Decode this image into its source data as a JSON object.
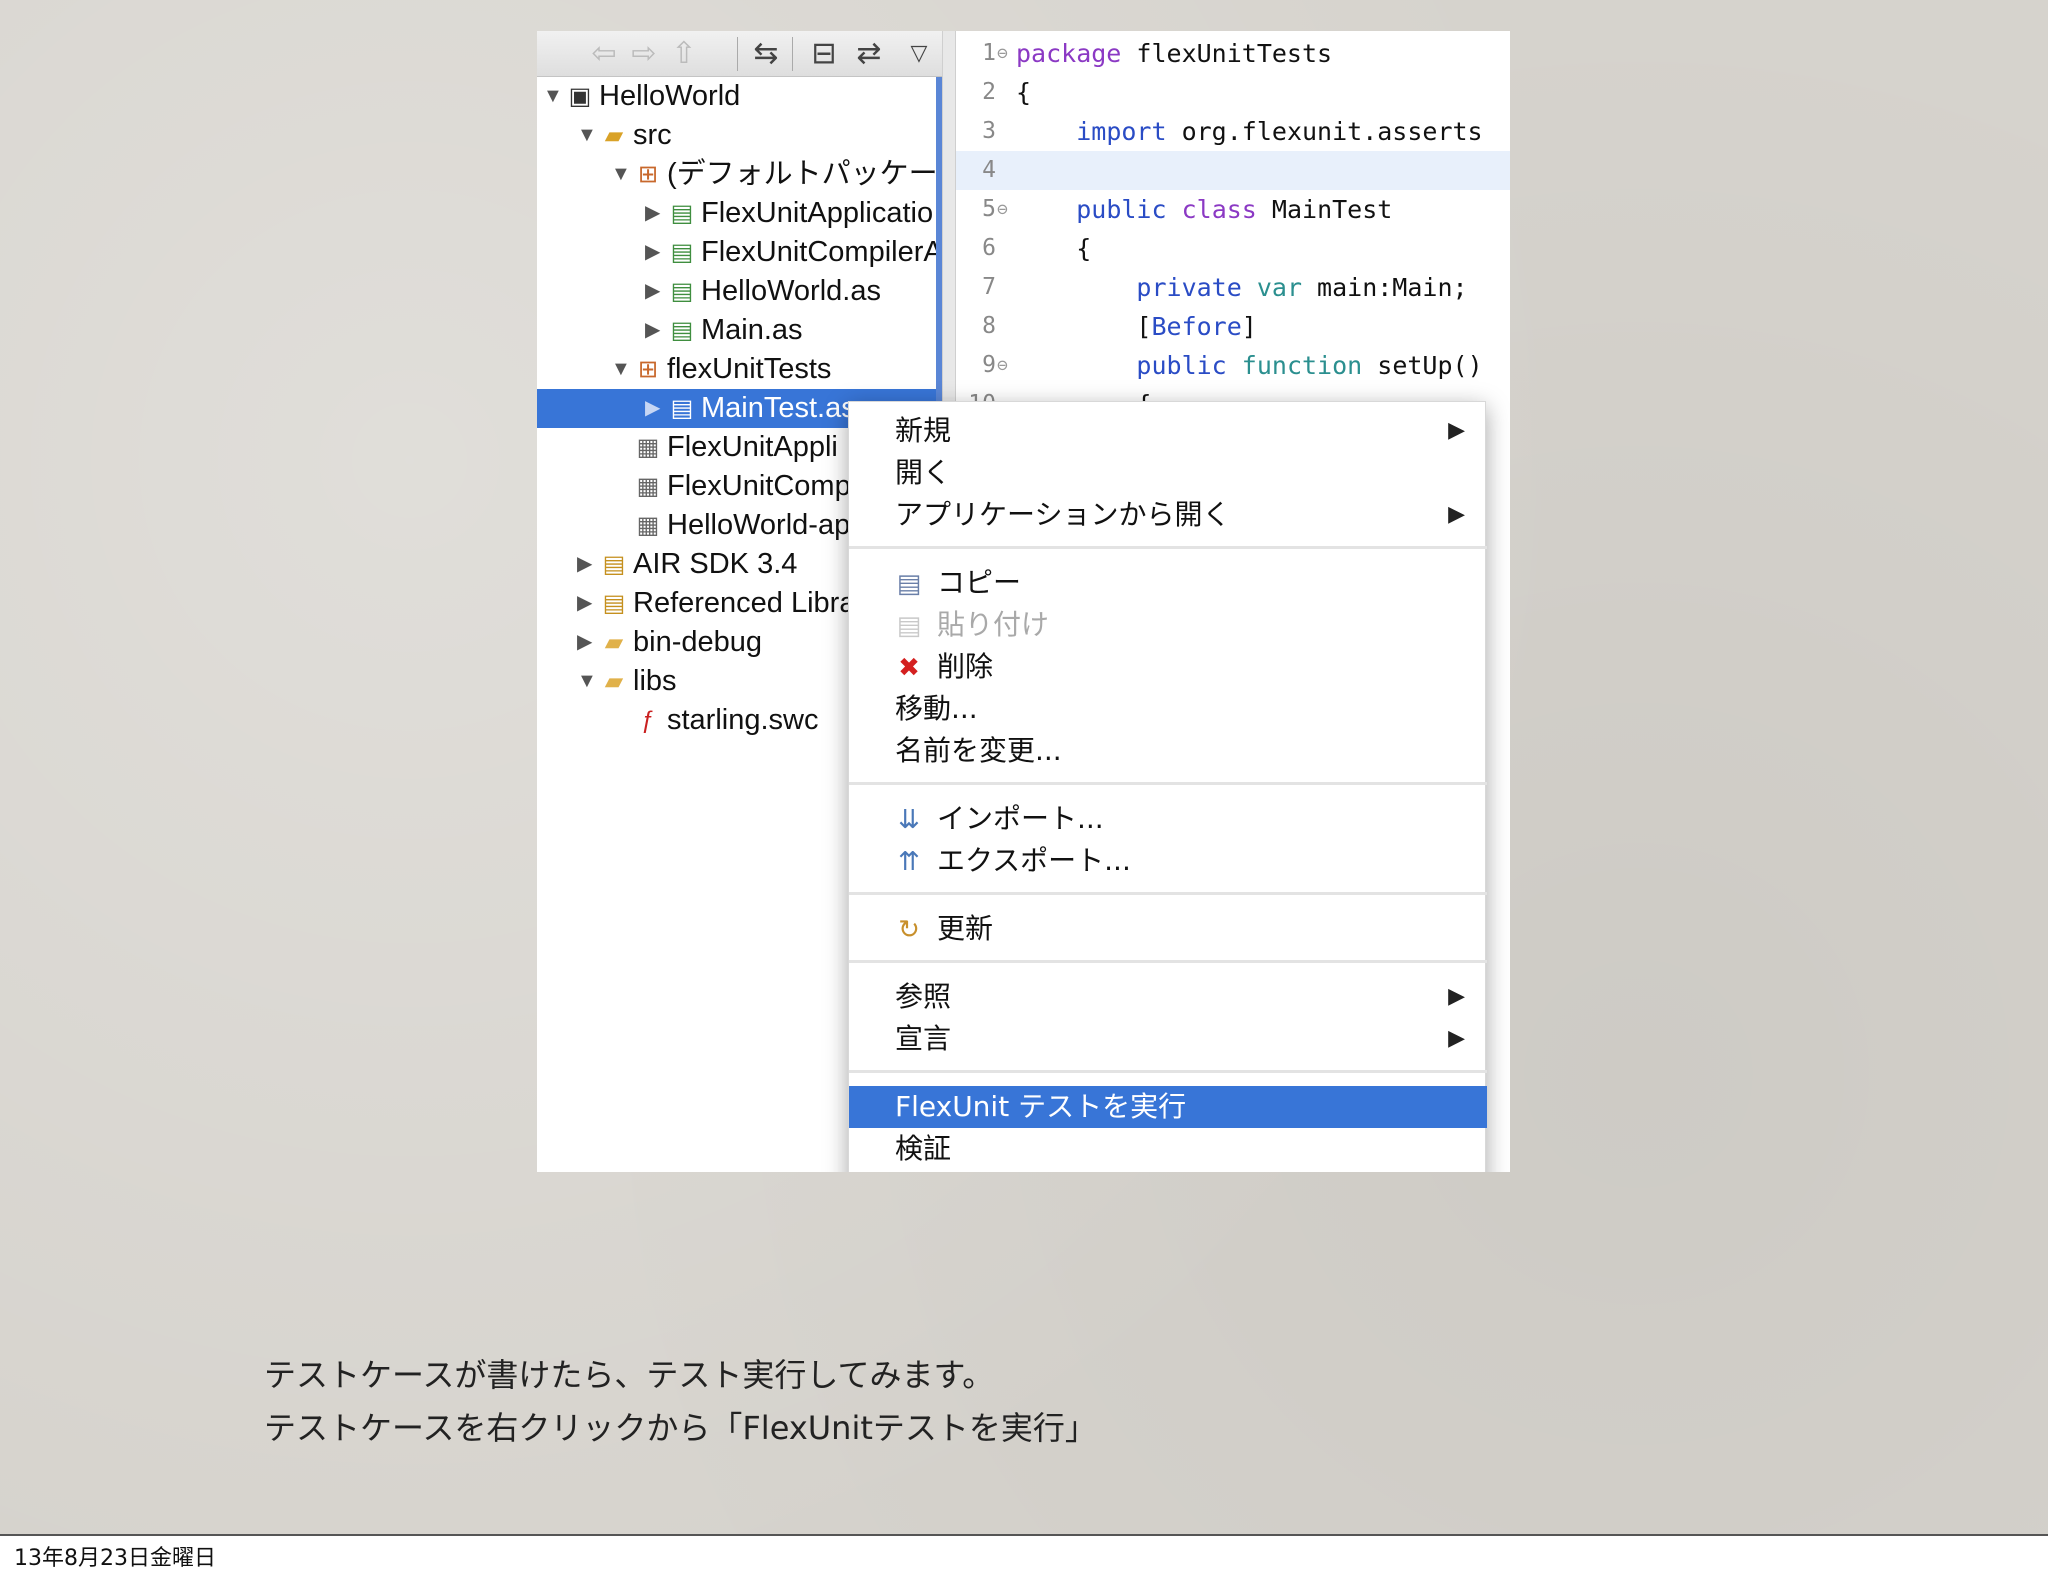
{
  "explorer": {
    "rows": [
      {
        "label": "HelloWorld",
        "expanded": true,
        "icon": "project-icon"
      },
      {
        "label": "src",
        "expanded": true,
        "icon": "source-folder-icon"
      },
      {
        "label": "(デフォルトパッケージ",
        "expanded": true,
        "icon": "package-icon"
      },
      {
        "label": "FlexUnitApplicatio",
        "expanded": false,
        "icon": "as-file-icon"
      },
      {
        "label": "FlexUnitCompilerA",
        "expanded": false,
        "icon": "as-file-icon"
      },
      {
        "label": "HelloWorld.as",
        "expanded": false,
        "icon": "as-file-icon"
      },
      {
        "label": "Main.as",
        "expanded": false,
        "icon": "as-file-icon"
      },
      {
        "label": "flexUnitTests",
        "expanded": true,
        "icon": "package-icon"
      },
      {
        "label": "MainTest.as",
        "expanded": false,
        "icon": "as-file-icon",
        "selected": true
      },
      {
        "label": "FlexUnitAppli",
        "icon": "mxml-file-icon"
      },
      {
        "label": "FlexUnitComp",
        "icon": "mxml-file-icon"
      },
      {
        "label": "HelloWorld-ap",
        "icon": "mxml-file-icon"
      },
      {
        "label": "AIR SDK 3.4",
        "expanded": false,
        "icon": "library-icon"
      },
      {
        "label": "Referenced Libra",
        "expanded": false,
        "icon": "library-icon"
      },
      {
        "label": "bin-debug",
        "expanded": false,
        "icon": "folder-icon"
      },
      {
        "label": "libs",
        "expanded": true,
        "icon": "folder-icon"
      },
      {
        "label": "starling.swc",
        "icon": "swc-file-icon"
      }
    ]
  },
  "editor": {
    "lines": [
      {
        "num": "1",
        "fold": "⊖",
        "tokens": [
          [
            "kw",
            "package"
          ],
          [
            "",
            " flexUnitTests"
          ]
        ]
      },
      {
        "num": "2",
        "fold": "",
        "tokens": [
          [
            "",
            "{"
          ]
        ]
      },
      {
        "num": "3",
        "fold": "",
        "tokens": [
          [
            "",
            "    "
          ],
          [
            "kb",
            "import"
          ],
          [
            "",
            " org.flexunit.asserts"
          ]
        ]
      },
      {
        "num": "4",
        "fold": "",
        "tokens": [
          [
            "",
            ""
          ]
        ]
      },
      {
        "num": "5",
        "fold": "⊖",
        "tokens": [
          [
            "",
            "    "
          ],
          [
            "kb",
            "public"
          ],
          [
            "",
            " "
          ],
          [
            "kw",
            "class"
          ],
          [
            "",
            " MainTest"
          ]
        ]
      },
      {
        "num": "6",
        "fold": "",
        "tokens": [
          [
            "",
            "    {"
          ]
        ]
      },
      {
        "num": "7",
        "fold": "",
        "tokens": [
          [
            "",
            "        "
          ],
          [
            "kb",
            "private"
          ],
          [
            "",
            " "
          ],
          [
            "kt",
            "var"
          ],
          [
            "",
            " main:Main;"
          ]
        ]
      },
      {
        "num": "8",
        "fold": "",
        "tokens": [
          [
            "",
            "        ["
          ],
          [
            "kb",
            "Before"
          ],
          [
            "",
            "]"
          ]
        ]
      },
      {
        "num": "9",
        "fold": "⊖",
        "tokens": [
          [
            "",
            "        "
          ],
          [
            "kb",
            "public"
          ],
          [
            "",
            " "
          ],
          [
            "kt",
            "function"
          ],
          [
            "",
            " setUp()"
          ]
        ]
      },
      {
        "num": "10",
        "fold": "",
        "tokens": [
          [
            "",
            "        {"
          ]
        ]
      }
    ]
  },
  "context_menu": {
    "items": [
      {
        "label": "新規",
        "submenu": true
      },
      {
        "label": "開く"
      },
      {
        "label": "アプリケーションから開く",
        "submenu": true
      },
      {
        "sep": true
      },
      {
        "label": "コピー",
        "icon": "copy-icon"
      },
      {
        "label": "貼り付け",
        "icon": "paste-icon",
        "disabled": true
      },
      {
        "label": "削除",
        "icon": "delete-icon"
      },
      {
        "label": "移動..."
      },
      {
        "label": "名前を変更..."
      },
      {
        "sep": true
      },
      {
        "label": "インポート...",
        "icon": "import-icon"
      },
      {
        "label": "エクスポート...",
        "icon": "export-icon"
      },
      {
        "sep": true
      },
      {
        "label": "更新",
        "icon": "refresh-icon"
      },
      {
        "sep": true
      },
      {
        "label": "参照",
        "submenu": true
      },
      {
        "label": "宣言",
        "submenu": true
      },
      {
        "sep": true
      },
      {
        "label": "FlexUnit テストを実行",
        "highlighted": true
      },
      {
        "label": "検証"
      }
    ]
  },
  "caption": {
    "line1": "テストケースが書けたら、テスト実行してみます。",
    "line2": "テストケースを右クリックから「FlexUnitテストを実行」"
  },
  "footer": {
    "date": "13年8月23日金曜日"
  },
  "colors": {
    "selection": "#3875d7",
    "keyword_purple": "#8b39c4",
    "keyword_blue": "#2a4cc5"
  }
}
